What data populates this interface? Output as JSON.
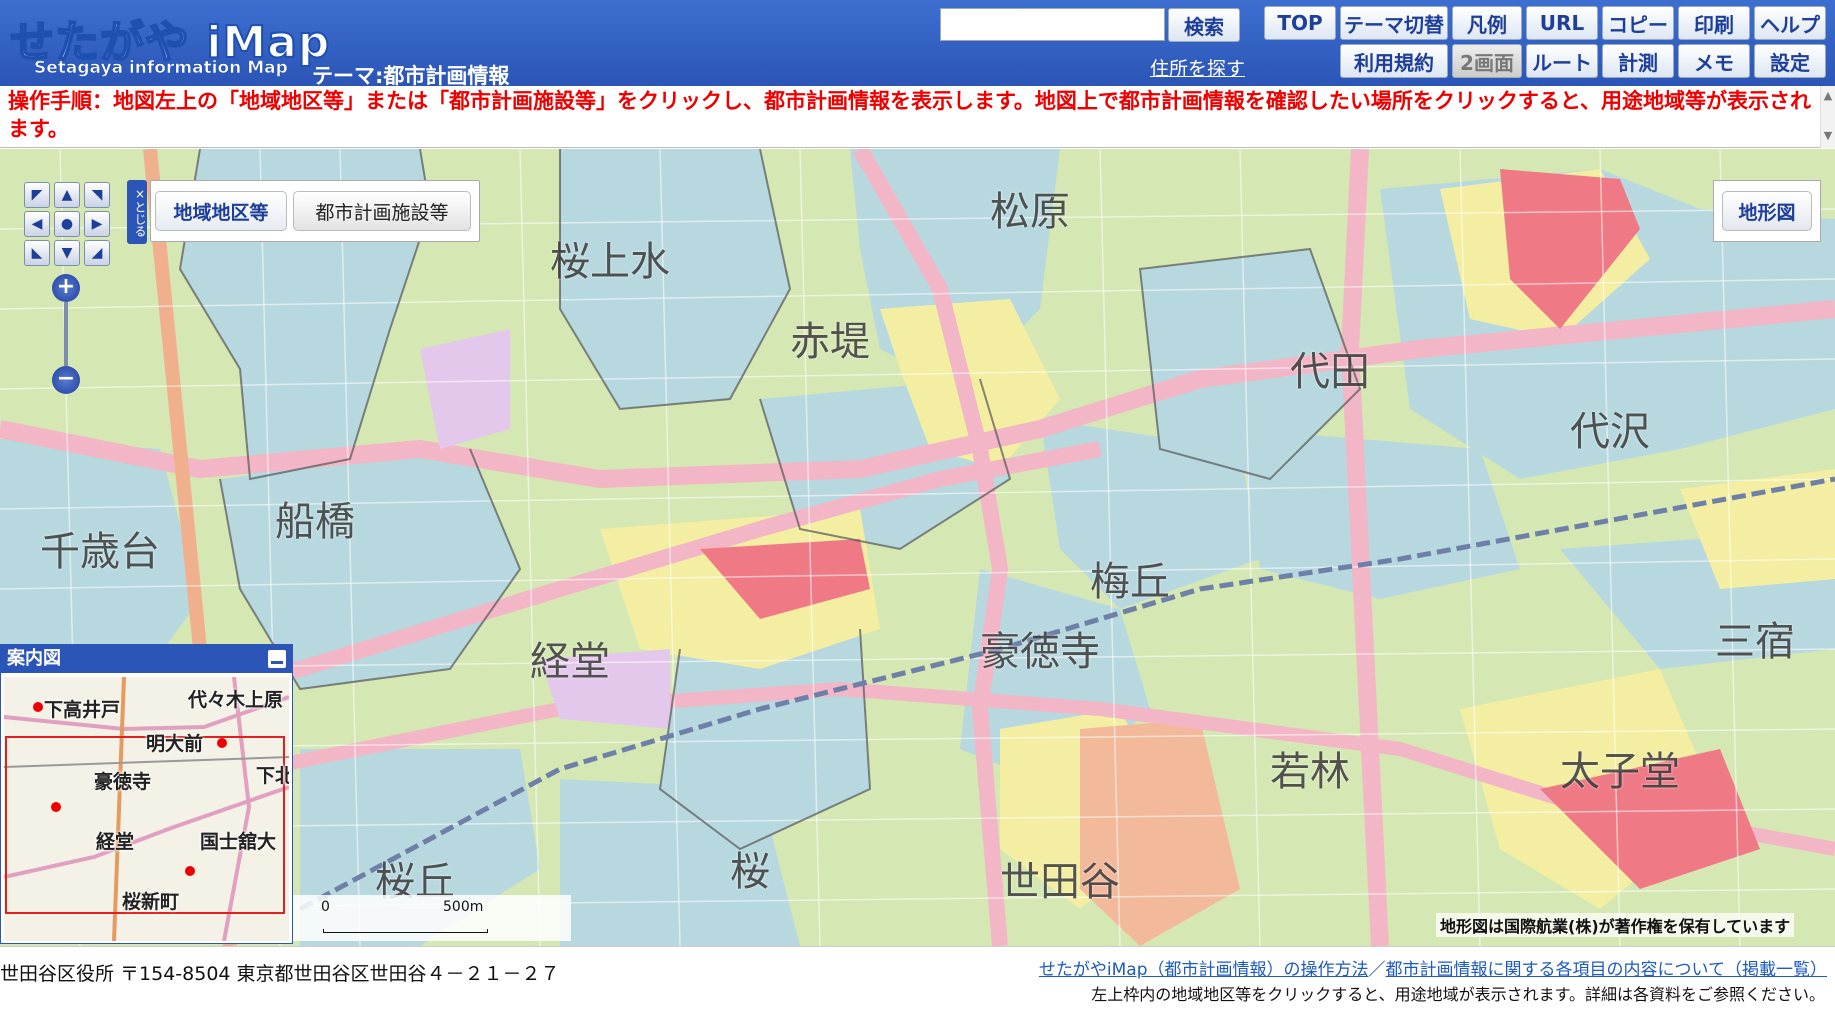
{
  "header": {
    "logo_main": "せたがや iMap",
    "logo_sub": "Setagaya information Map",
    "theme": "テーマ:都市計画情報",
    "search_placeholder": "",
    "search_button": "検索",
    "address_link": "住所を探す",
    "nav_row1": [
      "TOP",
      "テーマ切替",
      "凡例",
      "URL",
      "コピー",
      "印刷",
      "ヘルプ"
    ],
    "nav_row2": [
      "利用規約",
      "2画面",
      "ルート",
      "計測",
      "メモ",
      "設定"
    ]
  },
  "instruction": "操作手順：地図左上の「地域地区等」または「都市計画施設等」をクリックし、都市計画情報を表示します。地図上で都市計画情報を確認したい場所をクリックすると、用途地域等が表示されます。",
  "map": {
    "close_tab": "×とじる",
    "layer_buttons": [
      "地域地区等",
      "都市計画施設等"
    ],
    "terrain_button": "地形図",
    "area_labels": [
      "桜上水",
      "松原",
      "赤堤",
      "代田",
      "代沢",
      "船橋",
      "千歳台",
      "梅丘",
      "豪徳寺",
      "経堂",
      "若林",
      "三宿",
      "太子堂",
      "桜丘",
      "桜",
      "世田谷"
    ],
    "copyright": "地形図は国際航業(株)が著作権を保有しています",
    "scale": {
      "zero": "0",
      "distance": "500m"
    }
  },
  "guide_map": {
    "title": "案内図",
    "labels": [
      "下高井戸",
      "代々木上原",
      "明大前",
      "豪徳寺",
      "経堂",
      "国士舘大",
      "桜新町",
      "下北"
    ]
  },
  "footer": {
    "address": "世田谷区役所 〒154-8504 東京都世田谷区世田谷４－２１－２７",
    "link1": "せたがやiMap（都市計画情報）の操作方法",
    "separator": "／",
    "link2": "都市計画情報に関する各項目の内容について（掲載一覧）",
    "note": "左上枠内の地域地区等をクリックすると、用途地域が表示されます。詳細は各資料をご参照ください。"
  },
  "colors": {
    "header": "#2b55b6",
    "residential_blue": "#b7d9e2",
    "residential_green": "#cfe6a6",
    "commercial_pink": "#f5b8c4",
    "yellow": "#f5f0a6",
    "red": "#ef7a86"
  }
}
